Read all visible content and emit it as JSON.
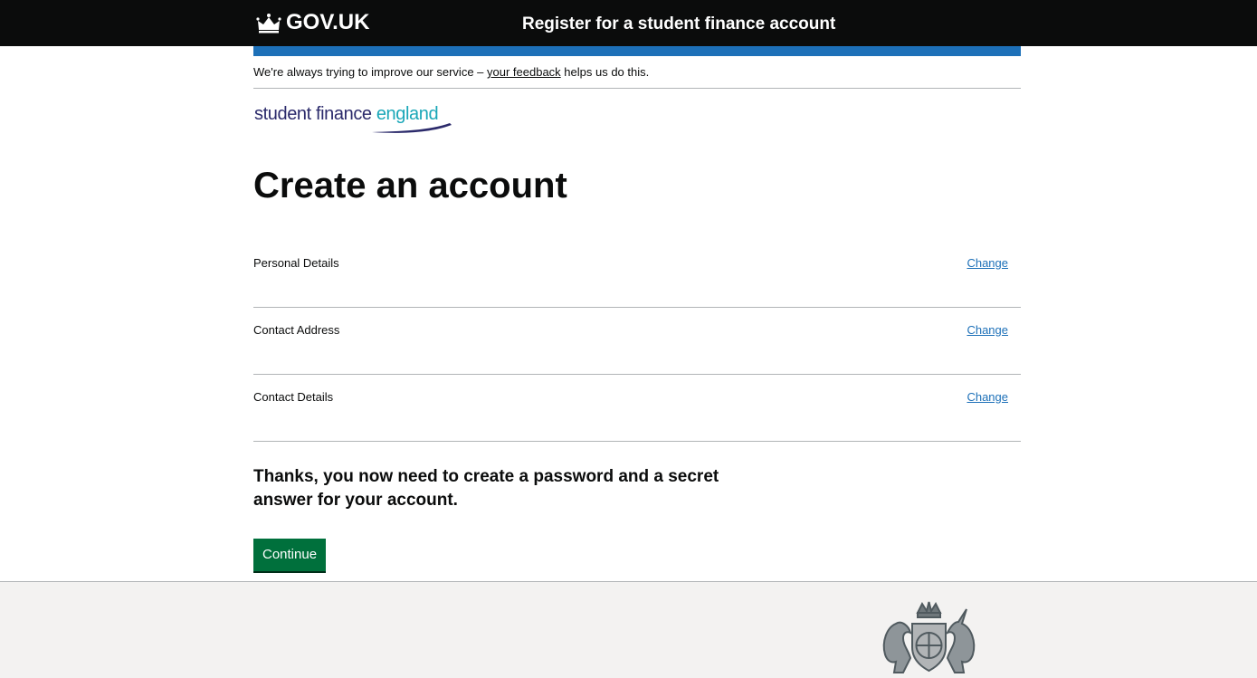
{
  "header": {
    "logo_text": "GOV.UK",
    "service_name": "Register for a student finance account"
  },
  "feedback": {
    "before": "We're always trying to improve our service – ",
    "link": "your feedback",
    "after": " helps us do this."
  },
  "sfe_logo": {
    "part1": "student finance ",
    "part2": "england"
  },
  "page": {
    "title": "Create an account"
  },
  "summary": [
    {
      "key": "Personal Details",
      "action": "Change"
    },
    {
      "key": "Contact Address",
      "action": "Change"
    },
    {
      "key": "Contact Details",
      "action": "Change"
    }
  ],
  "message": "Thanks, you now need to create a password and a secret answer for your account.",
  "continue_label": "Continue",
  "colors": {
    "header_bg": "#0b0c0c",
    "accent_blue": "#1d70b8",
    "link_blue": "#1d70b8",
    "button_green": "#00703c",
    "footer_bg": "#f3f2f1"
  },
  "icons": {
    "gov_logo": "crown-icon",
    "footer": "royal-coat-of-arms-icon"
  }
}
